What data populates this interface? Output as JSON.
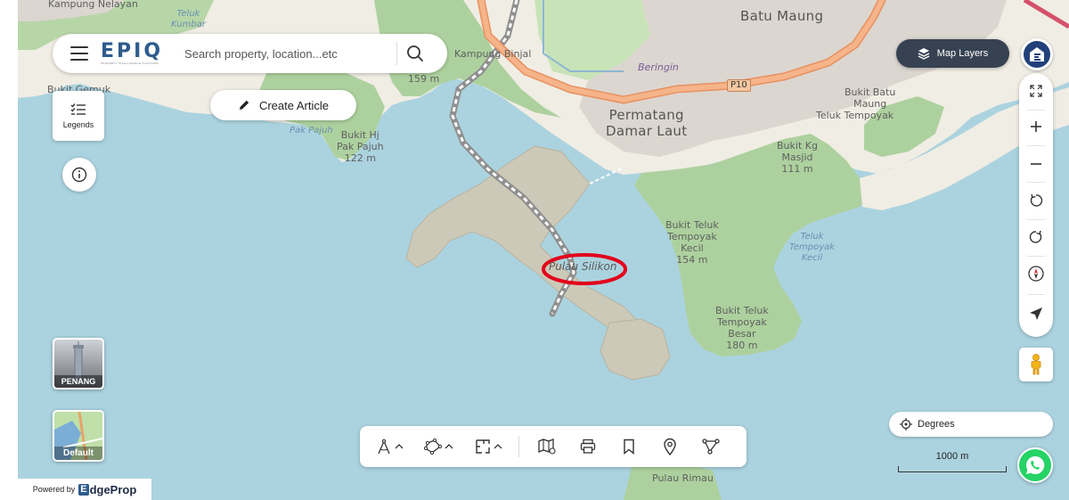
{
  "search": {
    "brand": "EPIQ",
    "brand_tagline": "PROPERTY INTELLIGENCE PLATFORM",
    "placeholder": "Search property, location...etc"
  },
  "buttons": {
    "create_article": "Create Article",
    "legends": "Legends",
    "map_layers": "Map Layers",
    "degrees": "Degrees"
  },
  "thumbnails": {
    "penang": "PENANG",
    "default": "Default"
  },
  "scale": {
    "label": "1000 m"
  },
  "footer": {
    "powered_by": "Powered by",
    "brand_rest": "dgeProp",
    "brand_initial": "E"
  },
  "map_labels": {
    "kampung_nelayan": "Kampung Nelayan",
    "teluk_kumbar": "Teluk\nKumbar",
    "bukit_gemuk": "Bukit Gemuk",
    "kampung_binjal": "Kampung Binjal",
    "bukit_159": "159 m",
    "beringin": "Beringin",
    "batu_maung": "Batu Maung",
    "p10": "P10",
    "permatang_damar_laut": "Permatang\nDamar Laut",
    "bukit_batu_maung": "Bukit Batu\nMaung",
    "teluk_tempoyak": "Teluk Tempoyak",
    "pak_pajuh": "Pak Pajuh",
    "bukit_hj_pak_pajuh": "Bukit Hj\nPak Pajuh\n122 m",
    "bukit_kg_masjid": "Bukit Kg\nMasjid\n111 m",
    "bukit_teluk_tempoyak_kecil": "Bukit Teluk\nTempoyak\nKecil\n154 m",
    "teluk_tempoyak_kecil_water": "Teluk\nTempoyak\nKecil",
    "pulau_silikon": "Pulau Silikon",
    "bukit_teluk_tempoyak_besar": "Bukit Teluk\nTempoyak\nBesar\n180 m",
    "pulau_rimau": "Pulau Rimau"
  },
  "colors": {
    "sea": "#abd3df",
    "land": "#f0ede4",
    "forest": "#add19e",
    "reclaimed": "#cdc9b8",
    "highway": "#f5a36d",
    "accent": "#364251",
    "highlight": "#e3001b"
  },
  "icons": {
    "menu": "hamburger-icon",
    "search": "magnifier-icon",
    "create": "pencil-icon",
    "legends": "checklist-icon",
    "info": "info-icon",
    "layers": "layers-icon",
    "fullscreen": "expand-icon",
    "zoom_in": "plus-icon",
    "zoom_out": "minus-icon",
    "rotate_left": "rotate-ccw-icon",
    "rotate_right": "rotate-cw-icon",
    "compass": "compass-icon",
    "locate": "navigation-arrow-icon",
    "street_view": "pegman-icon",
    "target": "crosshair-icon",
    "whatsapp": "whatsapp-icon"
  }
}
